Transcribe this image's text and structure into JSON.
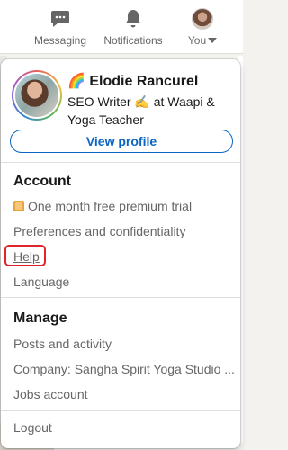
{
  "nav": {
    "messaging": {
      "label": "Messaging",
      "icon": "chat-bubble-icon"
    },
    "notifications": {
      "label": "Notifications",
      "icon": "bell-icon"
    },
    "me": {
      "label": "You",
      "icon": "avatar"
    }
  },
  "profile": {
    "name_emoji": "🌈",
    "name": "Elodie Rancurel",
    "headline": "SEO Writer ✍ at Waapi & Yoga Teacher",
    "view_profile_label": "View profile"
  },
  "account": {
    "title": "Account",
    "items": [
      {
        "label": "One month free premium trial",
        "icon": "premium-icon"
      },
      {
        "label": "Preferences and confidentiality"
      },
      {
        "label": "Help"
      },
      {
        "label": "Language"
      }
    ]
  },
  "manage": {
    "title": "Manage",
    "items": [
      {
        "label": "Posts and activity"
      },
      {
        "label": "Company: Sangha Spirit Yoga Studio ..."
      },
      {
        "label": "Jobs account"
      }
    ]
  },
  "logout_label": "Logout",
  "colors": {
    "brand_blue": "#0a66c2",
    "highlight_red": "#e0242b",
    "muted_text": "#666666"
  }
}
